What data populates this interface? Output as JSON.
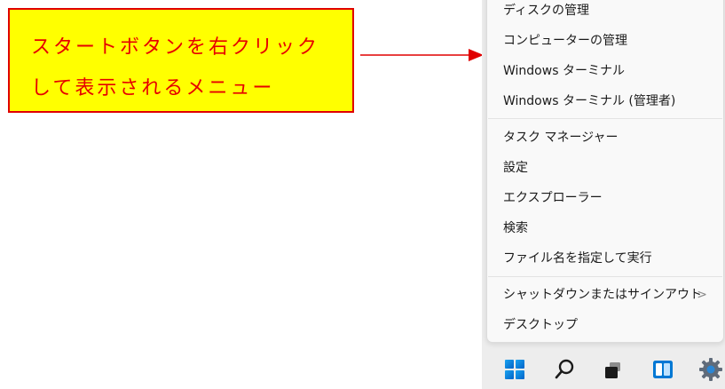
{
  "callout": {
    "line1": "スタートボタンを右クリック",
    "line2": "して表示されるメニュー"
  },
  "menu": {
    "items": [
      {
        "label": "ディスクの管理"
      },
      {
        "label": "コンピューターの管理"
      },
      {
        "label": "Windows ターミナル"
      },
      {
        "label": "Windows ターミナル (管理者)"
      },
      {
        "label": "タスク マネージャー"
      },
      {
        "label": "設定"
      },
      {
        "label": "エクスプローラー"
      },
      {
        "label": "検索"
      },
      {
        "label": "ファイル名を指定して実行"
      },
      {
        "label": "シャットダウンまたはサインアウト",
        "submenu_indicator": ">"
      },
      {
        "label": "デスクトップ"
      }
    ]
  },
  "taskbar": {
    "icons": [
      "windows-start-icon",
      "search-icon",
      "task-view-icon",
      "widgets-icon",
      "settings-gear-icon"
    ]
  },
  "colors": {
    "callout_background": "#ffff00",
    "callout_text": "#e60000",
    "callout_border": "#e00000",
    "arrow": "#e00000",
    "menu_background": "#f9f9f9",
    "windows_blue": "#0078d4"
  }
}
